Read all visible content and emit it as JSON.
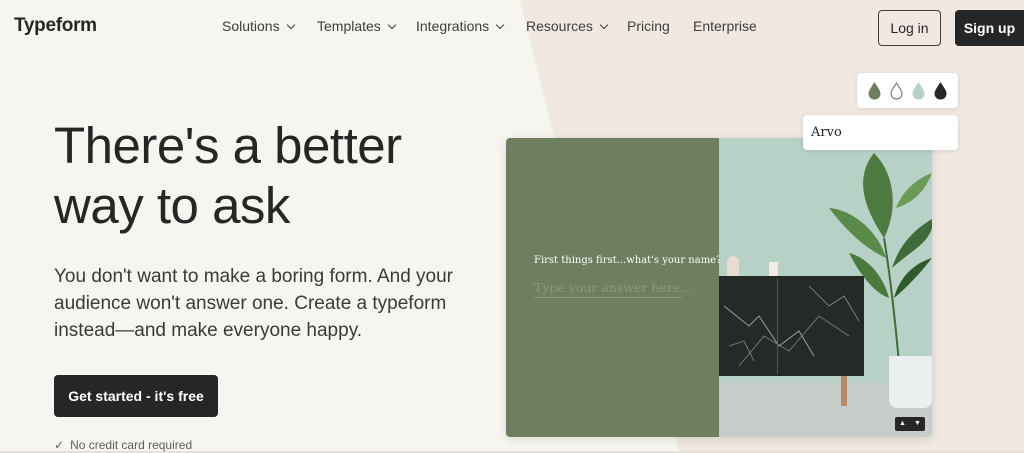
{
  "nav": {
    "logo": "Typeform",
    "menu": [
      {
        "label": "Solutions"
      },
      {
        "label": "Templates"
      },
      {
        "label": "Integrations"
      },
      {
        "label": "Resources"
      },
      {
        "label": "Pricing"
      },
      {
        "label": "Enterprise"
      }
    ],
    "login_label": "Log in",
    "signup_label": "Sign up"
  },
  "hero": {
    "headline": "There's a better way to ask",
    "subtext": "You don't want to make a boring form. And your audience won't answer one. Create a typeform instead—and make everyone happy.",
    "cta_label": "Get started - it's free",
    "no_card_text": "No credit card required",
    "check_glyph": "✓"
  },
  "preview": {
    "question": "First things first...what's your name?",
    "answer_placeholder": "Type your answer here...",
    "scroll_up": "▲",
    "scroll_down": "▼",
    "panel_color": "#6d7f5e"
  },
  "theme": {
    "swatches": [
      {
        "name": "green-drop-icon",
        "color": "#6d7f5e"
      },
      {
        "name": "white-drop-icon",
        "color": "#ffffff"
      },
      {
        "name": "mint-drop-icon",
        "color": "#b7d1c6"
      },
      {
        "name": "black-drop-icon",
        "color": "#262627"
      }
    ],
    "font_name": "Arvo"
  }
}
